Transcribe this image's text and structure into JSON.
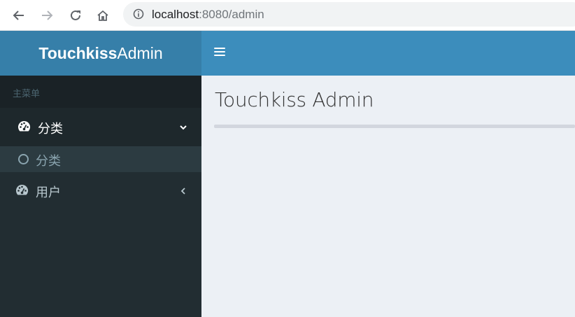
{
  "browser": {
    "url_host": "localhost",
    "url_rest": ":8080/admin",
    "icons": [
      "back-arrow-icon",
      "forward-arrow-icon",
      "reload-icon",
      "home-icon",
      "info-icon"
    ]
  },
  "header": {
    "logo_bold": "Touchkiss",
    "logo_light": "Admin",
    "toggle_icon": "hamburger-icon"
  },
  "sidebar": {
    "header": "主菜单",
    "items": [
      {
        "label": "分类",
        "icon": "dashboard-icon",
        "expanded": true,
        "children": [
          {
            "label": "分类",
            "icon": "circle-icon"
          }
        ]
      },
      {
        "label": "用户",
        "icon": "dashboard-icon",
        "expanded": false
      }
    ]
  },
  "content": {
    "title": "Touchkiss Admin"
  },
  "colors": {
    "logo_bg": "#367fa9",
    "topbar_bg": "#3c8dbc",
    "sidebar_bg": "#222d32",
    "content_bg": "#ecf0f5"
  }
}
